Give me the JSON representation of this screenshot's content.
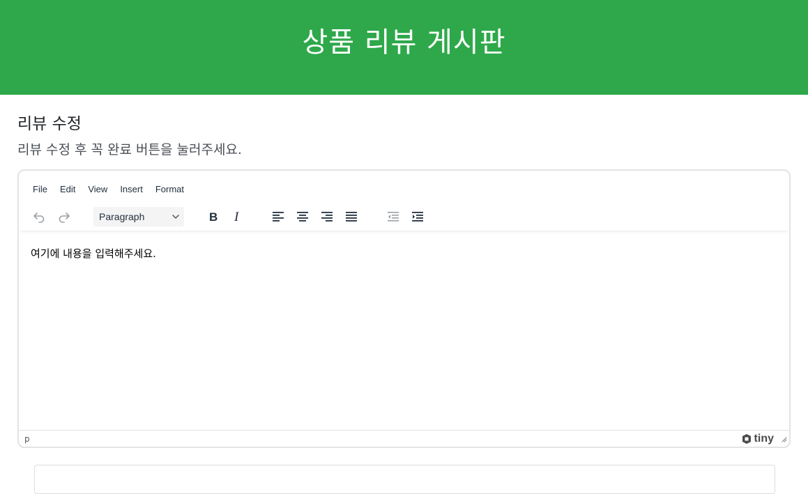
{
  "header": {
    "title": "상품 리뷰 게시판",
    "bg_color": "#2ea84a"
  },
  "section": {
    "title": "리뷰 수정",
    "description": "리뷰 수정 후 꼭 완료 버튼을 눌러주세요."
  },
  "editor": {
    "menu": [
      "File",
      "Edit",
      "View",
      "Insert",
      "Format"
    ],
    "block_format": "Paragraph",
    "toolbar_icons": [
      "undo-icon",
      "redo-icon",
      "bold-icon",
      "italic-icon",
      "align-left-icon",
      "align-center-icon",
      "align-right-icon",
      "align-justify-icon",
      "outdent-icon",
      "indent-icon"
    ],
    "content": "여기에 내용을 입력해주세요.",
    "status_path": "p",
    "brand": "tiny"
  }
}
